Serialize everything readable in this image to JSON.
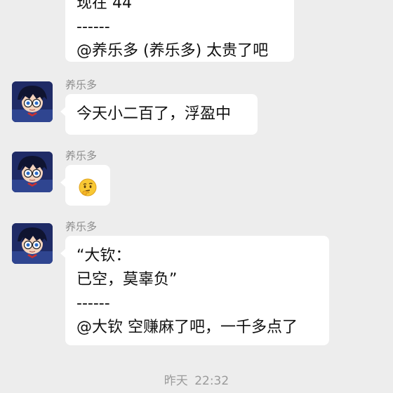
{
  "messages": [
    {
      "lines": [
        "现在 44",
        "------",
        "@养乐多 (养乐多) 太贵了吧"
      ]
    },
    {
      "sender": "养乐多",
      "lines": [
        "今天小二百了，浮盈中"
      ]
    },
    {
      "sender": "养乐多",
      "emoji": "thinking-face-emoji"
    },
    {
      "sender": "养乐多",
      "lines": [
        "“大钦：",
        "已空，莫辜负”",
        "------",
        "@大钦 空赚麻了吧，一千多点了"
      ]
    }
  ],
  "timestamp": "昨天 22:32",
  "avatar_icon": "detective-boy-avatar-icon",
  "colors": {
    "background": "#ededed",
    "bubble": "#ffffff",
    "sender_text": "#8c8c8c",
    "timestamp_text": "#9a9a9a"
  }
}
